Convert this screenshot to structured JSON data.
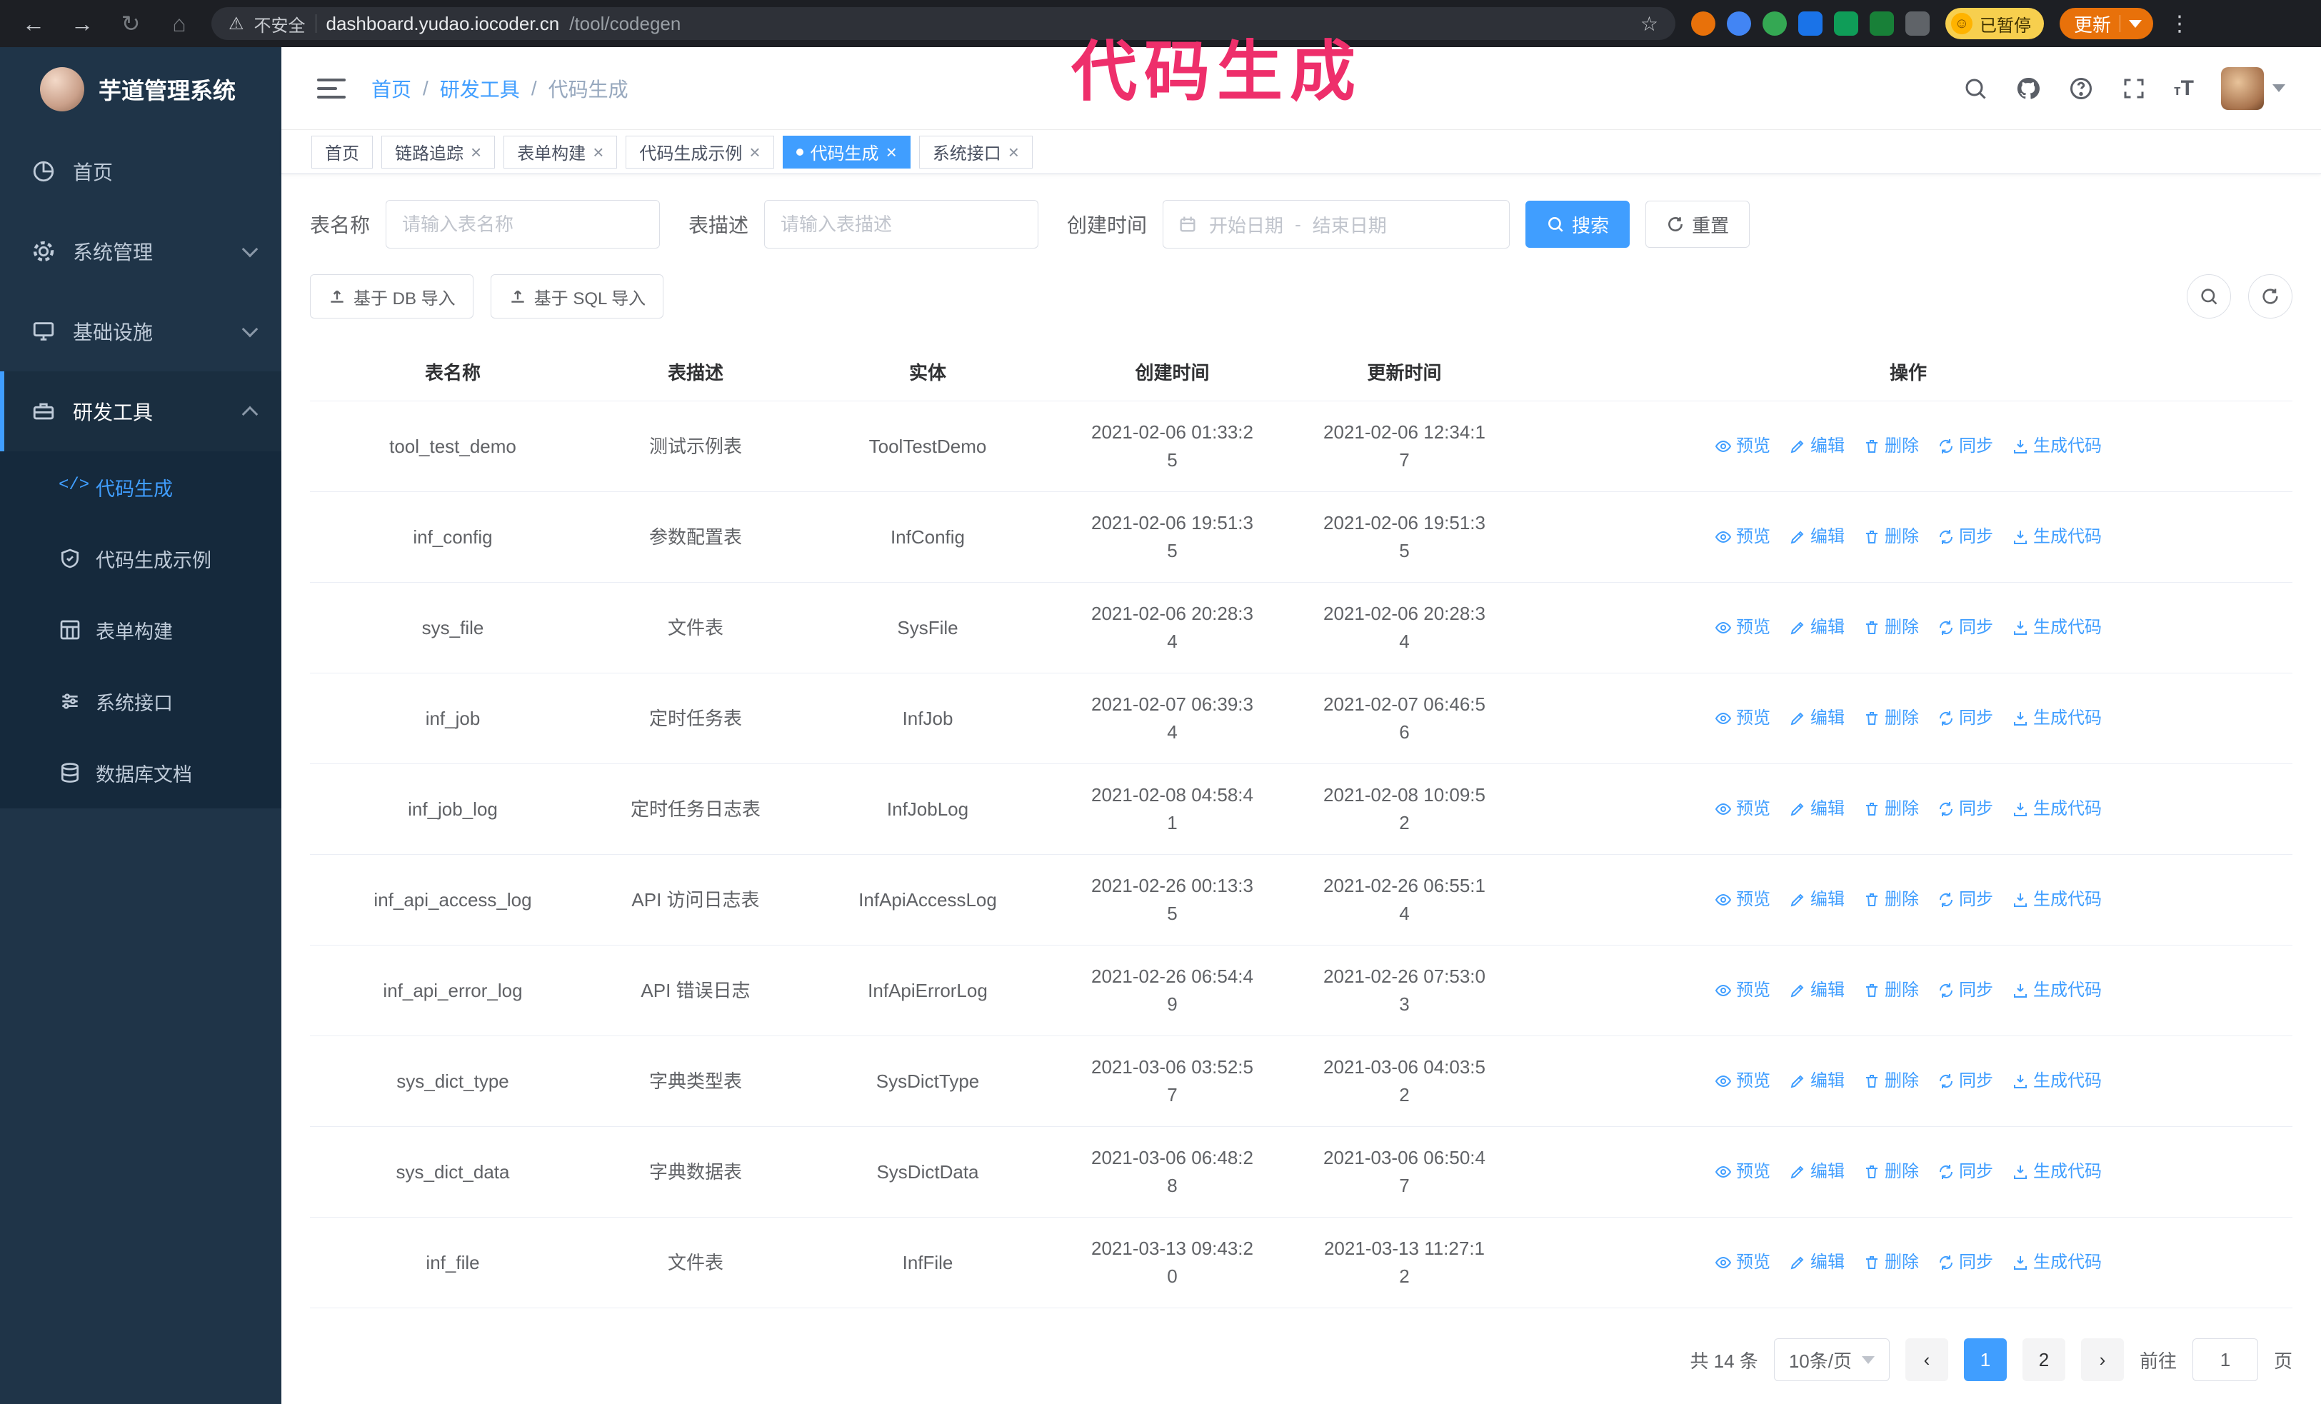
{
  "browser": {
    "security_label": "不安全",
    "url_host": "dashboard.yudao.iocoder.cn",
    "url_path": "/tool/codegen",
    "paused_badge": "已暂停",
    "update_label": "更新"
  },
  "annotation": {
    "text": "代码生成"
  },
  "sidebar": {
    "logo_title": "芋道管理系统",
    "menu": [
      {
        "id": "home",
        "label": "首页"
      },
      {
        "id": "system",
        "label": "系统管理"
      },
      {
        "id": "infra",
        "label": "基础设施"
      },
      {
        "id": "devtools",
        "label": "研发工具"
      }
    ],
    "submenu": [
      {
        "id": "codegen",
        "label": "代码生成",
        "active": true
      },
      {
        "id": "codegen-example",
        "label": "代码生成示例",
        "active": false
      },
      {
        "id": "form-build",
        "label": "表单构建",
        "active": false
      },
      {
        "id": "system-api",
        "label": "系统接口",
        "active": false
      },
      {
        "id": "db-doc",
        "label": "数据库文档",
        "active": false
      }
    ]
  },
  "header": {
    "breadcrumb": [
      "首页",
      "研发工具",
      "代码生成"
    ]
  },
  "tags": [
    {
      "id": "home",
      "label": "首页",
      "active": false,
      "closable": false
    },
    {
      "id": "tracer",
      "label": "链路追踪",
      "active": false,
      "closable": true
    },
    {
      "id": "form-build",
      "label": "表单构建",
      "active": false,
      "closable": true
    },
    {
      "id": "codegen-example",
      "label": "代码生成示例",
      "active": false,
      "closable": true
    },
    {
      "id": "codegen",
      "label": "代码生成",
      "active": true,
      "closable": true
    },
    {
      "id": "system-api",
      "label": "系统接口",
      "active": false,
      "closable": true
    }
  ],
  "filters": {
    "table_name_label": "表名称",
    "table_name_placeholder": "请输入表名称",
    "table_desc_label": "表描述",
    "table_desc_placeholder": "请输入表描述",
    "create_time_label": "创建时间",
    "start_date_placeholder": "开始日期",
    "range_separator": "-",
    "end_date_placeholder": "结束日期",
    "search_label": "搜索",
    "reset_label": "重置"
  },
  "toolbar": {
    "import_db_label": "基于 DB 导入",
    "import_sql_label": "基于 SQL 导入"
  },
  "table": {
    "columns": [
      "表名称",
      "表描述",
      "实体",
      "创建时间",
      "更新时间",
      "操作"
    ],
    "row_actions": [
      {
        "name": "preview-link",
        "icon": "eye-icon",
        "label": "预览"
      },
      {
        "name": "edit-link",
        "icon": "edit-icon",
        "label": "编辑"
      },
      {
        "name": "delete-link",
        "icon": "delete-icon",
        "label": "删除"
      },
      {
        "name": "sync-link",
        "icon": "sync-icon",
        "label": "同步"
      },
      {
        "name": "generate-code-link",
        "icon": "download-icon",
        "label": "生成代码"
      }
    ],
    "rows": [
      {
        "name": "tool_test_demo",
        "desc": "测试示例表",
        "entity": "ToolTestDemo",
        "create_time": "2021-02-06 01:33:25",
        "update_time": "2021-02-06 12:34:17"
      },
      {
        "name": "inf_config",
        "desc": "参数配置表",
        "entity": "InfConfig",
        "create_time": "2021-02-06 19:51:35",
        "update_time": "2021-02-06 19:51:35"
      },
      {
        "name": "sys_file",
        "desc": "文件表",
        "entity": "SysFile",
        "create_time": "2021-02-06 20:28:34",
        "update_time": "2021-02-06 20:28:34"
      },
      {
        "name": "inf_job",
        "desc": "定时任务表",
        "entity": "InfJob",
        "create_time": "2021-02-07 06:39:34",
        "update_time": "2021-02-07 06:46:56"
      },
      {
        "name": "inf_job_log",
        "desc": "定时任务日志表",
        "entity": "InfJobLog",
        "create_time": "2021-02-08 04:58:41",
        "update_time": "2021-02-08 10:09:52"
      },
      {
        "name": "inf_api_access_log",
        "desc": "API 访问日志表",
        "entity": "InfApiAccessLog",
        "create_time": "2021-02-26 00:13:35",
        "update_time": "2021-02-26 06:55:14"
      },
      {
        "name": "inf_api_error_log",
        "desc": "API 错误日志",
        "entity": "InfApiErrorLog",
        "create_time": "2021-02-26 06:54:49",
        "update_time": "2021-02-26 07:53:03"
      },
      {
        "name": "sys_dict_type",
        "desc": "字典类型表",
        "entity": "SysDictType",
        "create_time": "2021-03-06 03:52:57",
        "update_time": "2021-03-06 04:03:52"
      },
      {
        "name": "sys_dict_data",
        "desc": "字典数据表",
        "entity": "SysDictData",
        "create_time": "2021-03-06 06:48:28",
        "update_time": "2021-03-06 06:50:47"
      },
      {
        "name": "inf_file",
        "desc": "文件表",
        "entity": "InfFile",
        "create_time": "2021-03-13 09:43:20",
        "update_time": "2021-03-13 11:27:12"
      }
    ]
  },
  "pagination": {
    "total_text": "共 14 条",
    "page_size": "10条/页",
    "pages": [
      "1",
      "2"
    ],
    "active_page": "1",
    "goto_label": "前往",
    "goto_value": "1",
    "goto_suffix": "页"
  },
  "colors": {
    "accent": "#409eff",
    "sidebar_bg": "#1f3448",
    "submenu_bg": "#15293c",
    "annotation": "#ee2f6b",
    "active_tag_bg": "#409eff"
  },
  "icons": {
    "warning": "⚠",
    "star": "☆",
    "back": "←",
    "forward": "→",
    "reload": "↻",
    "home": "⌂",
    "caret": "▾",
    "prev": "‹",
    "next": "›",
    "kebab": "⋮",
    "close": "×"
  }
}
